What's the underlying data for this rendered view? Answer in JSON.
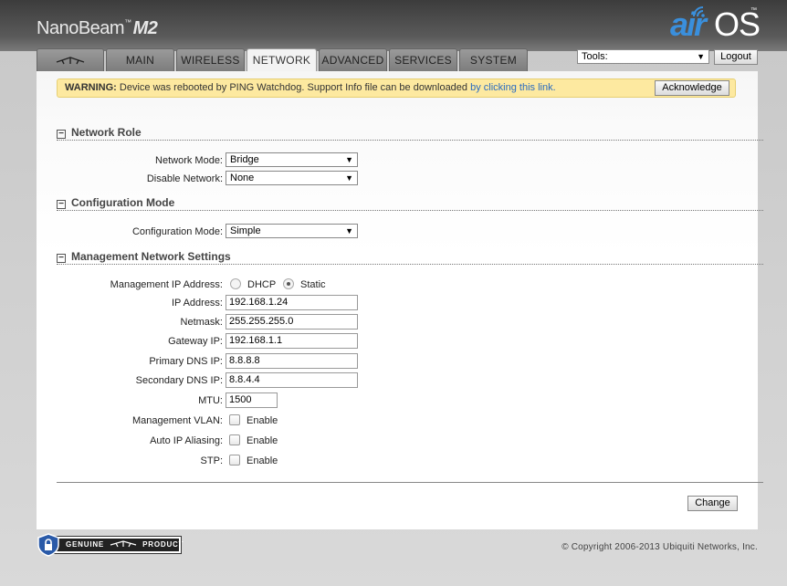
{
  "header": {
    "product_name": "NanoBeam",
    "product_tm": "™",
    "product_model": "M2",
    "logo_air": "air",
    "logo_os": "OS",
    "logo_tm": "™"
  },
  "tabs": [
    {
      "label": "",
      "icon": "ubiquiti-logo-icon"
    },
    {
      "label": "MAIN"
    },
    {
      "label": "WIRELESS"
    },
    {
      "label": "NETWORK",
      "active": true
    },
    {
      "label": "ADVANCED"
    },
    {
      "label": "SERVICES"
    },
    {
      "label": "SYSTEM"
    }
  ],
  "toolbar": {
    "tools_value": "Tools:",
    "logout_label": "Logout"
  },
  "warning": {
    "prefix": "WARNING:",
    "text": " Device was rebooted by PING Watchdog. Support Info file can be downloaded ",
    "link": "by clicking this link.",
    "ack_label": "Acknowledge",
    "bg_color": "#fde9a0"
  },
  "network_role": {
    "title": "Network Role",
    "network_mode_label": "Network Mode:",
    "network_mode_value": "Bridge",
    "disable_network_label": "Disable Network:",
    "disable_network_value": "None"
  },
  "configuration_mode": {
    "title": "Configuration Mode",
    "label": "Configuration Mode:",
    "value": "Simple"
  },
  "management": {
    "title": "Management Network Settings",
    "ip_mode_label": "Management IP Address:",
    "dhcp_label": "DHCP",
    "static_label": "Static",
    "selected": "Static",
    "ip_label": "IP Address:",
    "ip_value": "192.168.1.24",
    "netmask_label": "Netmask:",
    "netmask_value": "255.255.255.0",
    "gateway_label": "Gateway IP:",
    "gateway_value": "192.168.1.1",
    "dns1_label": "Primary DNS IP:",
    "dns1_value": "8.8.8.8",
    "dns2_label": "Secondary DNS IP:",
    "dns2_value": "8.8.4.4",
    "mtu_label": "MTU:",
    "mtu_value": "1500",
    "vlan_label": "Management VLAN:",
    "vlan_enable": "Enable",
    "alias_label": "Auto IP Aliasing:",
    "alias_enable": "Enable",
    "stp_label": "STP:",
    "stp_enable": "Enable"
  },
  "actions": {
    "change_label": "Change"
  },
  "footer": {
    "badge_text": "GENUINE",
    "badge_text2": "PRODUCT",
    "copyright": "© Copyright 2006-2013 Ubiquiti Networks, Inc."
  }
}
